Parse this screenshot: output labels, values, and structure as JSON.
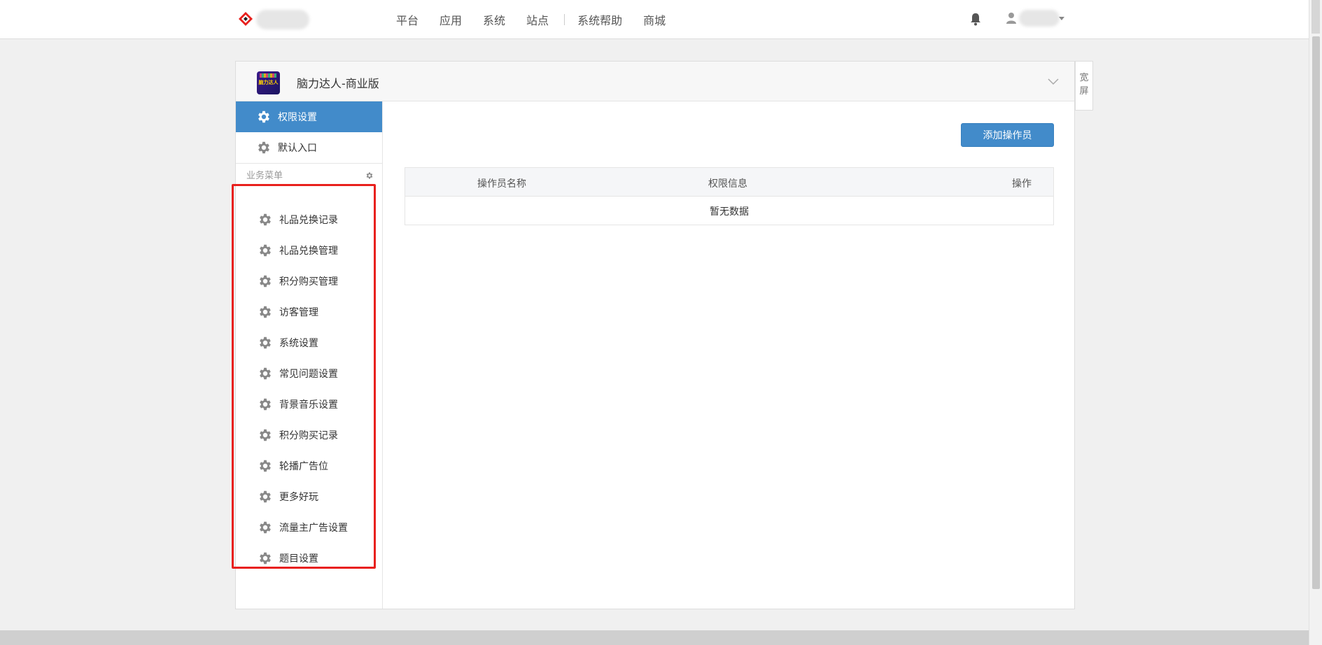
{
  "topnav": {
    "items": [
      {
        "label": "平台"
      },
      {
        "label": "应用"
      },
      {
        "label": "系统"
      },
      {
        "label": "站点"
      },
      {
        "label": "系统帮助"
      },
      {
        "label": "商城"
      }
    ]
  },
  "panel": {
    "app_title": "脑力达人-商业版",
    "app_icon_text": "脑力达人",
    "wide_label_1": "宽",
    "wide_label_2": "屏"
  },
  "sidebar": {
    "top_items": [
      {
        "label": "权限设置",
        "active": true
      },
      {
        "label": "默认入口",
        "active": false
      }
    ],
    "section_label": "业务菜单",
    "biz_items": [
      {
        "label": "礼品兑换记录"
      },
      {
        "label": "礼品兑换管理"
      },
      {
        "label": "积分购买管理"
      },
      {
        "label": "访客管理"
      },
      {
        "label": "系统设置"
      },
      {
        "label": "常见问题设置"
      },
      {
        "label": "背景音乐设置"
      },
      {
        "label": "积分购买记录"
      },
      {
        "label": "轮播广告位"
      },
      {
        "label": "更多好玩"
      },
      {
        "label": "流量主广告设置"
      },
      {
        "label": "题目设置"
      }
    ]
  },
  "content": {
    "add_button": "添加操作员",
    "table": {
      "columns": [
        "操作员名称",
        "权限信息",
        "操作"
      ],
      "empty_text": "暂无数据"
    }
  },
  "colors": {
    "primary": "#428bca",
    "highlight": "#e8201d"
  }
}
